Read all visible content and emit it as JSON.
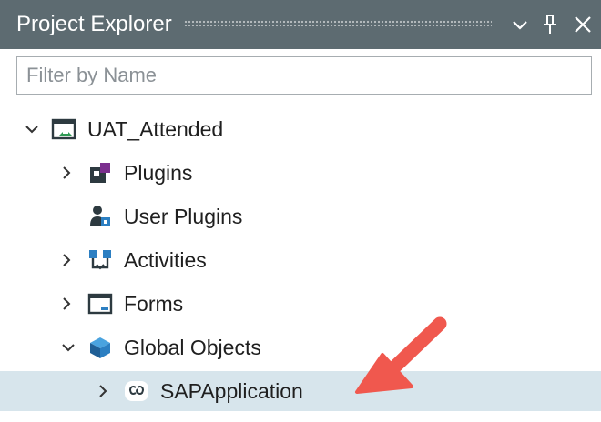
{
  "panel": {
    "title": "Project Explorer"
  },
  "filter": {
    "placeholder": "Filter by Name",
    "value": ""
  },
  "tree": {
    "root": {
      "label": "UAT_Attended",
      "icon": "project-window-icon",
      "expanded": true
    },
    "items": [
      {
        "label": "Plugins",
        "icon": "plugin-icon",
        "expandable": true,
        "expanded": false
      },
      {
        "label": "User Plugins",
        "icon": "user-plugins-icon",
        "expandable": false
      },
      {
        "label": "Activities",
        "icon": "activities-icon",
        "expandable": true,
        "expanded": false
      },
      {
        "label": "Forms",
        "icon": "form-window-icon",
        "expandable": true,
        "expanded": false
      },
      {
        "label": "Global Objects",
        "icon": "cube-icon",
        "expandable": true,
        "expanded": true
      },
      {
        "label": "SAPApplication",
        "icon": "global-object-link-icon",
        "expandable": true,
        "expanded": false,
        "selected": true
      }
    ]
  },
  "colors": {
    "titlebar": "#5d6b71",
    "selection": "#d7e5ec",
    "annotation_arrow": "#f0584e"
  }
}
